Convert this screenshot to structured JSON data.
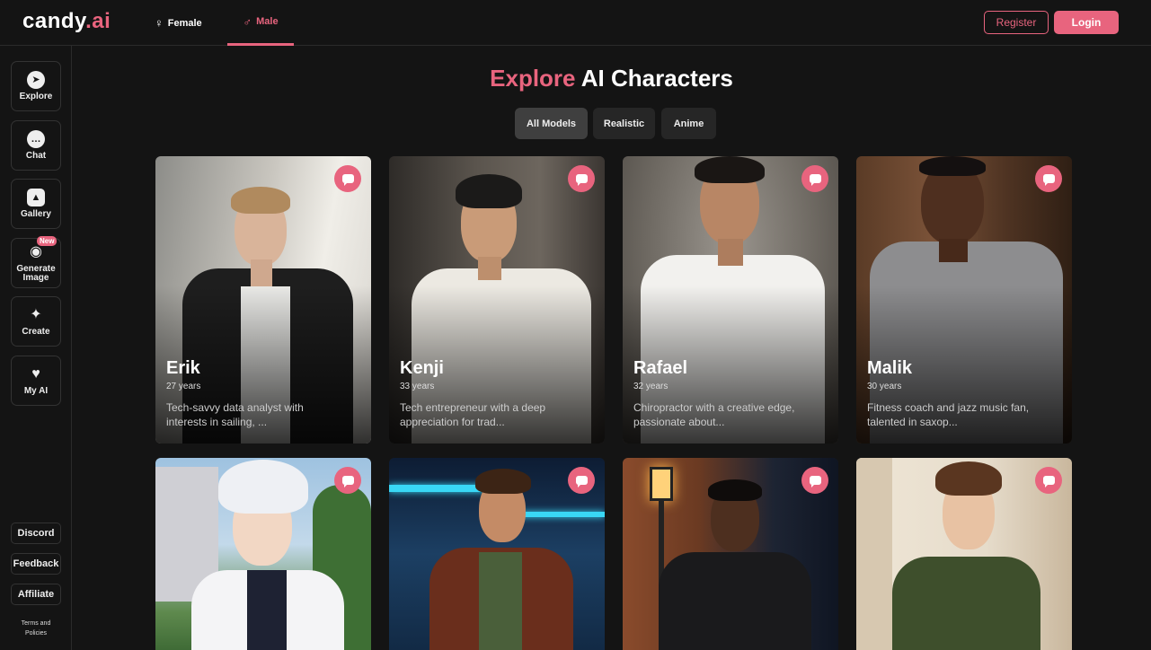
{
  "header": {
    "logo_main": "candy",
    "logo_accent": ".ai",
    "tabs": [
      {
        "symbol": "♀",
        "label": "Female"
      },
      {
        "symbol": "♂",
        "label": "Male"
      }
    ],
    "register_label": "Register",
    "login_label": "Login"
  },
  "sidebar": {
    "items": [
      {
        "label": "Explore",
        "icon": "compass-icon"
      },
      {
        "label": "Chat",
        "icon": "chat-bubble-icon"
      },
      {
        "label": "Gallery",
        "icon": "image-icon"
      },
      {
        "label": "Generate Image",
        "icon": "camera-icon",
        "badge": "New"
      },
      {
        "label": "Create",
        "icon": "magic-wand-icon"
      },
      {
        "label": "My AI",
        "icon": "heart-icon"
      }
    ],
    "bottom": [
      {
        "label": "Discord"
      },
      {
        "label": "Feedback"
      },
      {
        "label": "Affiliate"
      }
    ],
    "terms_line1": "Terms and",
    "terms_line2": "Policies"
  },
  "main": {
    "title_accent": "Explore",
    "title_rest": "AI Characters",
    "filters": [
      {
        "label": "All Models",
        "active": true
      },
      {
        "label": "Realistic",
        "active": false
      },
      {
        "label": "Anime",
        "active": false
      }
    ]
  },
  "characters": [
    {
      "name": "Erik",
      "age": "27 years",
      "desc_line1": "Tech-savvy data analyst with",
      "desc_line2": "interests in sailing, ..."
    },
    {
      "name": "Kenji",
      "age": "33 years",
      "desc_line1": "Tech entrepreneur with a deep",
      "desc_line2": "appreciation for trad..."
    },
    {
      "name": "Rafael",
      "age": "32 years",
      "desc_line1": "Chiropractor with a creative edge,",
      "desc_line2": "passionate about..."
    },
    {
      "name": "Malik",
      "age": "30 years",
      "desc_line1": "Fitness coach and jazz music fan,",
      "desc_line2": "talented in saxop..."
    }
  ],
  "colors": {
    "accent": "#e8647e",
    "background": "#141414"
  }
}
